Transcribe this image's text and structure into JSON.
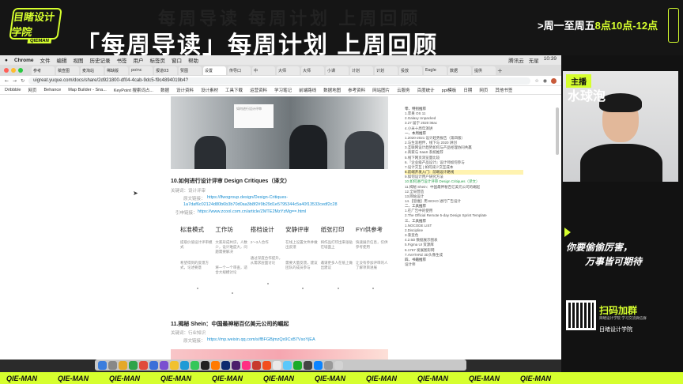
{
  "stream": {
    "logo_text": "目睹设计学院",
    "logo_sub": "QIEMAN",
    "ghost_text": "每周导读 每周计划 上周回顾",
    "headline": "「每周导读」每周计划  上周回顾",
    "schedule_prefix": ">周一至周五",
    "schedule_highlight": "8点10点-12点",
    "host_tag": "主播",
    "host_name": "水球泡",
    "slogan_line1": "你要偷偷厉害，",
    "slogan_line2": "万事皆可期待",
    "qr_title": "扫码加群",
    "qr_sub": "目睹设计学院 学习交流微信群",
    "qr_brand": "目睹设计学院",
    "ticker_item": "QIE-MAN",
    "accent": "#d6ff2e"
  },
  "menubar": {
    "items": [
      "Chrome",
      "文件",
      "编辑",
      "视图",
      "历史记录",
      "书签",
      "用户",
      "标签页",
      "窗口",
      "帮助"
    ],
    "right": [
      "腾讯云",
      "无星",
      "10:39"
    ]
  },
  "tabs": [
    "参考",
    "稿查图",
    "麦淘站",
    "稀缺版",
    "poinc",
    "报道03",
    "赞图",
    "设置",
    "传导口",
    "中",
    "大师",
    "大师",
    "小课",
    "计划",
    "计划",
    "投放",
    "Eagle",
    "数据",
    "提供"
  ],
  "address": {
    "url": "uigreat.yuque.com/docs/share/2d921800-df04-4cab-9dc5-f9c4894019b4?"
  },
  "bookmarks": [
    "Dribbble",
    "网页",
    "Behance",
    "Map Builder - Sna...",
    "KeyPoint 搜索词占...",
    "数据",
    "设计资料",
    "设计素材",
    "工具下载",
    "运营资料",
    "学习笔记",
    "前端路线",
    "数据地图",
    "参考资料",
    "网站图片",
    "云服务",
    "百度统计",
    "ppt模板",
    "日期",
    "网页",
    "其他书签"
  ],
  "article": {
    "title": "10.如何进行设计评审 Design Critiques（译文）",
    "keywords": "关键词：设计评审",
    "origin_label": "原文链接：",
    "origin_url": "https://lfwogroup.design/Design-Critiques-1a7daf6c0212 4d80b6b3b70d0aa3b8f2#9b29d1e5795344c5a40f1353 3cedf2c28",
    "origin_url_1": "https://lfwogroup.design/Design-Critiques-",
    "origin_url_2": "1a7daf6c02124d80b6b3b70d0aa3b8f2#9b29d1e5795344c5a40f13533cedf2c28",
    "translate_label": "引申链接：",
    "translate_url": "https://www.zcool.com.cn/article/ZMTE2MzYzMg==.html",
    "photo_caption": "如何进行设计评审",
    "columns": [
      {
        "head": "标准模式",
        "p1": "提取价值设计评审模式",
        "p2": "希望得到的反馈方式，论述要意"
      },
      {
        "head": "工作坊",
        "p1": "大家形成共识，人数少，设计难度大，问题需要解决",
        "p2": "将一个一个审查，适合大规模讨论"
      },
      {
        "head": "搭档设计",
        "p1": "2～3人合作",
        "p2": "通过深度合作提升，从需求层面讨论"
      },
      {
        "head": "安静评审",
        "p1": "在线上设置文件并做出反馈",
        "p2": "需要大量反馈，建议团队的成员参与"
      },
      {
        "head": "纸张打印",
        "p1": "将作品打印出来张贴在墙面上",
        "p2": "邀请更多人在纸上做出建议"
      },
      {
        "head": "FYI供参考",
        "p1": "快速展示信息，仅供参考使用",
        "p2": "让没有参加评审的人了解项目进展"
      }
    ],
    "title2": "11.揭秘 Shein：中国最神秘百亿美元公司的崛起",
    "keywords2": "关键词：行业知识",
    "origin_url2": "https://mp.weixin.qq.com/s/fBFGBjmzQx9CxB7VsoYjEA"
  },
  "toc": [
    {
      "t": "零、特别推荐",
      "c": "sec"
    },
    {
      "t": "1.苹果 OS 11",
      "c": ""
    },
    {
      "t": "2.Galaxy Unpacked",
      "c": ""
    },
    {
      "t": "3.27 届宁 2020 iMac",
      "c": ""
    },
    {
      "t": "4.小米十周年演讲",
      "c": ""
    },
    {
      "t": "一、本周推荐",
      "c": "sec"
    },
    {
      "t": "1.2020-2021 设计趋势报告（第四版）",
      "c": ""
    },
    {
      "t": "2.与生涯相伴，线下与 2020 讲创",
      "c": ""
    },
    {
      "t": "3.互联网设计趋势如何与产品经理协同共赢",
      "c": ""
    },
    {
      "t": "4.商家与 SaaS 系统推荐",
      "c": ""
    },
    {
      "t": "5.线下网页浏览量比较",
      "c": ""
    },
    {
      "t": "6.『企业级产品设计』设计师如何参与",
      "c": ""
    },
    {
      "t": "7.设计交互 | 如何减少交互成本",
      "c": ""
    },
    {
      "t": "8.前端开发入门：前端设计路线",
      "c": "sel"
    },
    {
      "t": "9.如何设计用户研究方法",
      "c": ""
    },
    {
      "t": "10.如何进行设计评审 Design Critiques（译文）",
      "c": "hit"
    },
    {
      "t": "11.揭秘 Shein：中国最神秘百亿美元公司的崛起",
      "c": ""
    },
    {
      "t": "12.全局营造",
      "c": ""
    },
    {
      "t": "13.网站设计",
      "c": ""
    },
    {
      "t": "14.【思维】用 BCKO 进行广告设计",
      "c": ""
    },
    {
      "t": "二、工具推荐",
      "c": "sec"
    },
    {
      "t": "1.在广告中的使用",
      "c": ""
    },
    {
      "t": "2.The Official Remote 5-day Design Sprint Template",
      "c": ""
    },
    {
      "t": "三、工具推荐",
      "c": "sec"
    },
    {
      "t": "1.NOCODE LIST",
      "c": ""
    },
    {
      "t": "2.Discipline",
      "c": ""
    },
    {
      "t": "3.渐变色",
      "c": ""
    },
    {
      "t": "4.2.5D 数据展示图表",
      "c": ""
    },
    {
      "t": "5.Figma UI 资源库",
      "c": ""
    },
    {
      "t": "6.1767 发展图形网",
      "c": ""
    },
    {
      "t": "7.AVATARZ 3D头像生成",
      "c": ""
    },
    {
      "t": "四、书籍推荐",
      "c": "sec"
    },
    {
      "t": "设计师",
      "c": ""
    }
  ]
}
